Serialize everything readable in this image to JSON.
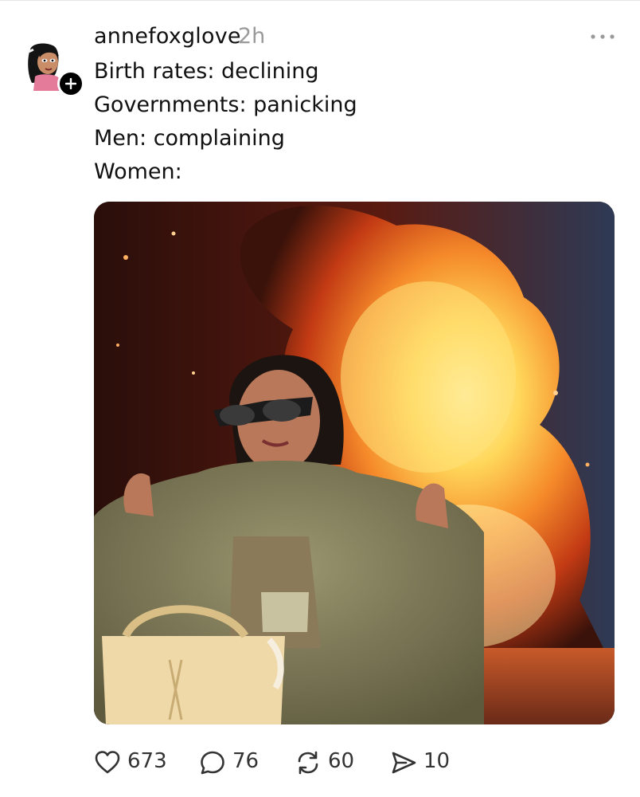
{
  "post": {
    "username": "annefoxglove",
    "time": "2h",
    "lines": [
      "Birth rates: declining",
      "Governments: panicking",
      "Men: complaining",
      "Women:"
    ]
  },
  "actions": {
    "likes": "673",
    "replies": "76",
    "reposts": "60",
    "shares": "10"
  },
  "icons": {
    "like": "heart-icon",
    "reply": "speech-bubble-icon",
    "repost": "repost-arrows-icon",
    "share": "paper-plane-icon",
    "more": "ellipsis-icon",
    "follow": "plus-icon"
  }
}
